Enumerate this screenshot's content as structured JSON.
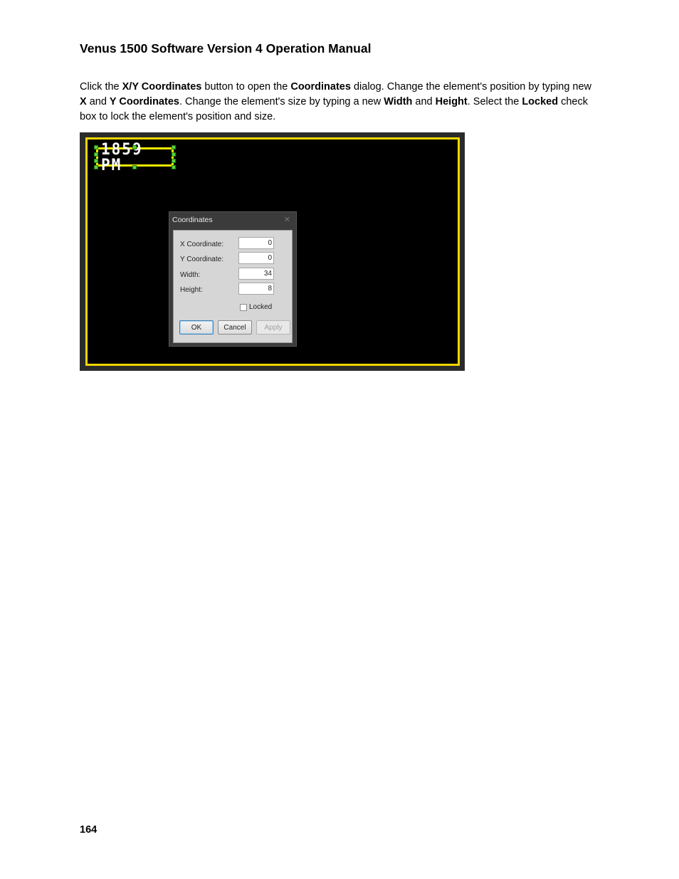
{
  "document": {
    "title": "Venus 1500 Software Version 4 Operation Manual",
    "page_number": "164",
    "intro": {
      "p1": "Click the ",
      "b1": "X/Y Coordinates",
      "p2": " button to open the ",
      "b2": "Coordinates",
      "p3": " dialog. Change the element's position by typing new ",
      "b3": "X",
      "p4": " and ",
      "b4": "Y Coordinates",
      "p5": ". Change the element's size by typing a new ",
      "b5": "Width",
      "p6": " and ",
      "b6": "Height",
      "p7": ". Select the ",
      "b7": "Locked",
      "p8": " check box to lock the element's position and size."
    }
  },
  "screenshot": {
    "led_text": "1859 PM",
    "colors": {
      "canvas_border": "#f2d600",
      "element_border": "#f2ec00",
      "handle": "#58d23c"
    },
    "dialog": {
      "title": "Coordinates",
      "close_glyph": "✕",
      "fields": [
        {
          "label": "X Coordinate:",
          "value": "0"
        },
        {
          "label": "Y Coordinate:",
          "value": "0"
        },
        {
          "label": "Width:",
          "value": "34"
        },
        {
          "label": "Height:",
          "value": "8"
        }
      ],
      "locked_label": "Locked",
      "locked": false,
      "buttons": {
        "ok": "OK",
        "cancel": "Cancel",
        "apply": "Apply"
      }
    }
  }
}
